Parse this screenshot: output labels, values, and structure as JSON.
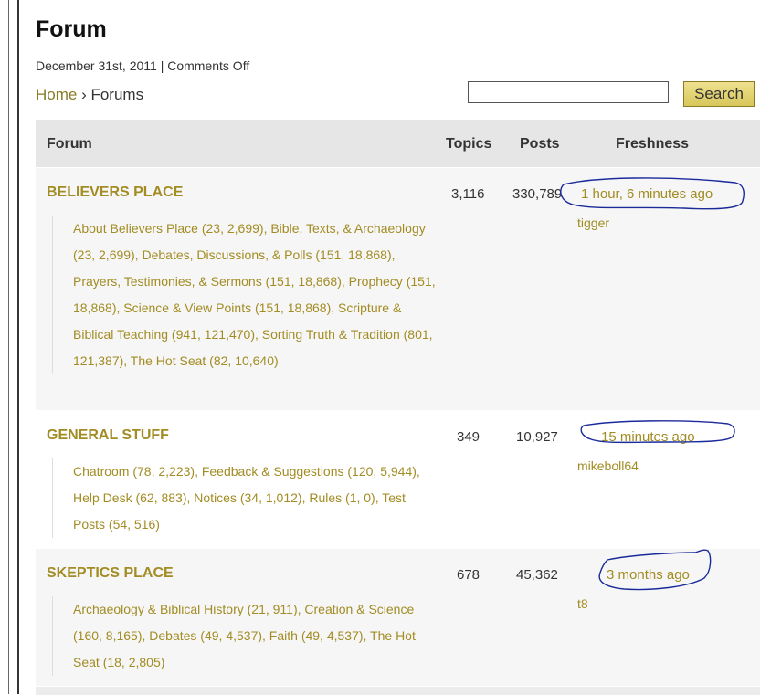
{
  "page": {
    "title": "Forum",
    "meta": "December 31st, 2011 | Comments Off"
  },
  "breadcrumb": {
    "home": "Home",
    "separator": " › ",
    "current": "Forums"
  },
  "search": {
    "value": "",
    "button_label": "Search"
  },
  "table": {
    "headers": {
      "forum": "Forum",
      "topics": "Topics",
      "posts": "Posts",
      "freshness": "Freshness"
    },
    "rows": [
      {
        "name": "BELIEVERS PLACE",
        "subforums": "About Believers Place (23, 2,699), Bible, Texts, & Archaeology (23, 2,699), Debates, Discussions, & Polls (151, 18,868), Prayers, Testimonies, & Sermons (151, 18,868), Prophecy (151, 18,868), Science & View Points (151, 18,868), Scripture & Biblical Teaching (941, 121,470), Sorting Truth & Tradition (801, 121,387), The Hot Seat (82, 10,640)",
        "topics": "3,116",
        "posts": "330,789",
        "freshness": "1 hour, 6 minutes ago",
        "last_user": "tigger"
      },
      {
        "name": "GENERAL STUFF",
        "subforums": "Chatroom (78, 2,223), Feedback & Suggestions (120, 5,944), Help Desk (62, 883), Notices (34, 1,012), Rules (1, 0), Test Posts (54, 516)",
        "topics": "349",
        "posts": "10,927",
        "freshness": "15 minutes ago",
        "last_user": "mikeboll64"
      },
      {
        "name": "SKEPTICS PLACE",
        "subforums": "Archaeology & Biblical History (21, 911), Creation & Science (160, 8,165), Debates (49, 4,537), Faith (49, 4,537), The Hot Seat (18, 2,805)",
        "topics": "678",
        "posts": "45,362",
        "freshness": "3 months ago",
        "last_user": "t8"
      }
    ]
  },
  "colors": {
    "link": "#a28c23",
    "header_bg": "#e6e6e6",
    "annotation": "#1a2a9a"
  }
}
